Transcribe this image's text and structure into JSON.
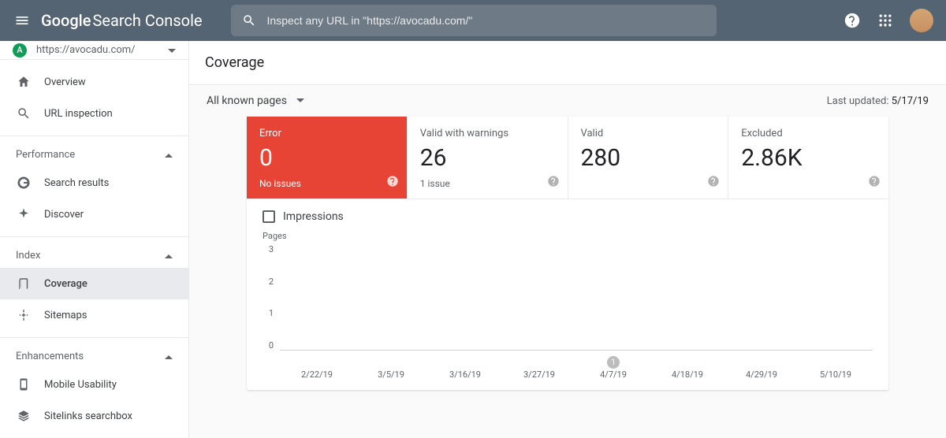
{
  "header": {
    "logo_g": "Google",
    "logo_rest": "Search Console",
    "search_placeholder": "Inspect any URL in \"https://avocadu.com/\""
  },
  "property": {
    "badge": "A",
    "url": "https://avocadu.com/"
  },
  "nav": {
    "overview": "Overview",
    "url_inspection": "URL inspection",
    "performance_hdr": "Performance",
    "search_results": "Search results",
    "discover": "Discover",
    "index_hdr": "Index",
    "coverage": "Coverage",
    "sitemaps": "Sitemaps",
    "enhancements_hdr": "Enhancements",
    "mobile_usability": "Mobile Usability",
    "sitelinks_searchbox": "Sitelinks searchbox"
  },
  "page": {
    "title": "Coverage",
    "filter_label": "All known pages",
    "last_updated_label": "Last updated: ",
    "last_updated_date": "5/17/19"
  },
  "tabs": {
    "error": {
      "label": "Error",
      "value": "0",
      "issues": "No issues"
    },
    "valid_warn": {
      "label": "Valid with warnings",
      "value": "26",
      "issues": "1 issue"
    },
    "valid": {
      "label": "Valid",
      "value": "280",
      "issues": ""
    },
    "excluded": {
      "label": "Excluded",
      "value": "2.86K",
      "issues": ""
    }
  },
  "chart": {
    "impressions_label": "Impressions",
    "ytitle": "Pages",
    "badge_value": "1"
  },
  "chart_data": {
    "type": "line",
    "title": "Pages",
    "ylabel": "Pages",
    "ylim": [
      0,
      3
    ],
    "yticks": [
      0,
      1,
      2,
      3
    ],
    "categories": [
      "2/22/19",
      "3/5/19",
      "3/16/19",
      "3/27/19",
      "4/7/19",
      "4/18/19",
      "4/29/19",
      "5/10/19"
    ],
    "series": [
      {
        "name": "Error",
        "values": [
          0,
          0,
          0,
          0,
          0,
          0,
          0,
          0
        ],
        "color": "#e84435"
      }
    ],
    "annotations": [
      {
        "x": "4/7/19",
        "label": "1"
      }
    ]
  }
}
